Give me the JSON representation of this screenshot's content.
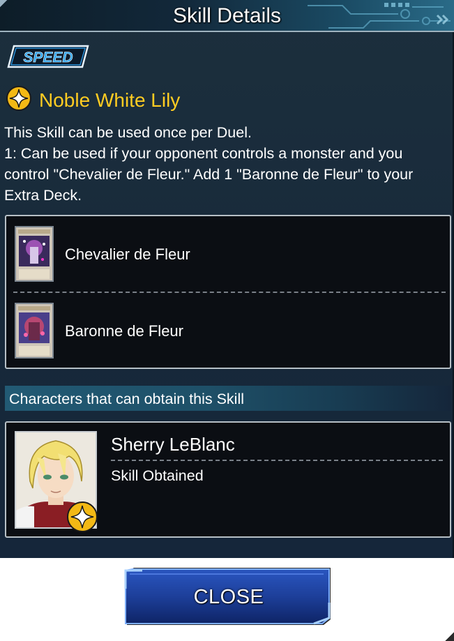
{
  "header": {
    "title": "Skill Details"
  },
  "skill": {
    "type_badge": "SPEED",
    "name": "Noble White Lily",
    "icon": "star-skill-icon",
    "description": [
      "This Skill can be used once per Duel.",
      "1: Can be used if your opponent controls a monster and you control \"Chevalier de Fleur.\" Add 1 \"Baronne de Fleur\" to your Extra Deck."
    ]
  },
  "cards": [
    {
      "name": "Chevalier de Fleur",
      "thumb_name": "Chevalier de Fleur",
      "icon": "card-thumbnail"
    },
    {
      "name": "Baronne de Fleur",
      "thumb_name": "Baronne de Fleur",
      "icon": "card-thumbnail"
    }
  ],
  "characters_section": {
    "title": "Characters that can obtain this Skill"
  },
  "characters": [
    {
      "name": "Sherry LeBlanc",
      "status": "Skill Obtained",
      "icon": "character-portrait"
    }
  ],
  "footer": {
    "close_label": "CLOSE"
  },
  "colors": {
    "skill_name": "#ffcc22",
    "panel_bg": "#1a2d3c",
    "close_button": "#1d3f9a"
  }
}
